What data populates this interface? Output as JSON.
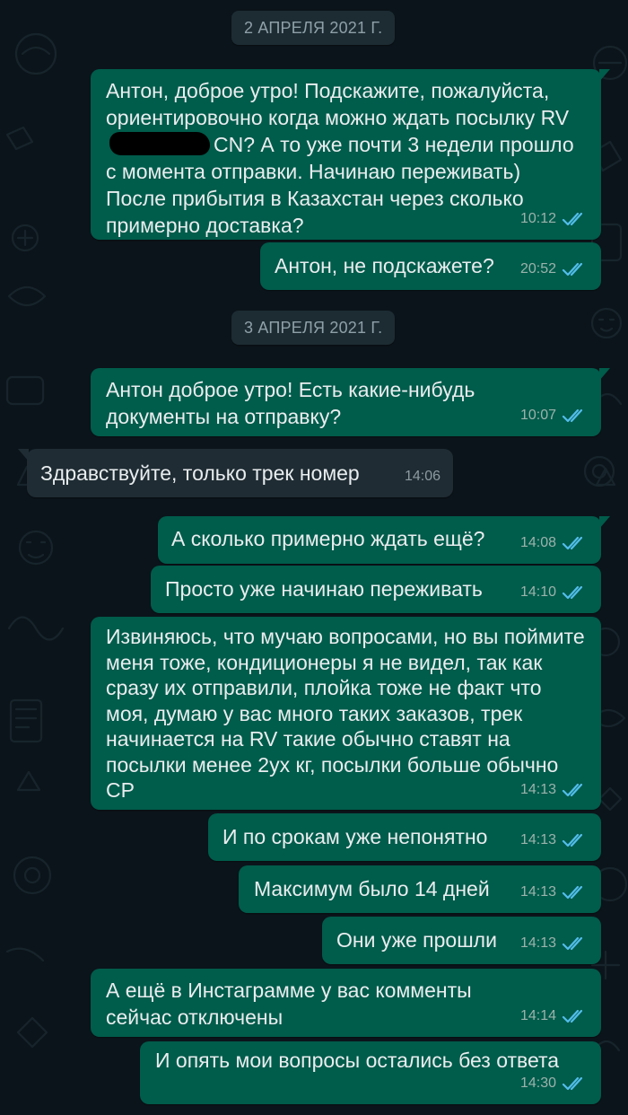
{
  "colors": {
    "background": "#0b141a",
    "outgoing_bubble": "#005c4b",
    "incoming_bubble": "#1f2c33",
    "read_ticks": "#53bdeb",
    "date_pill": "#1d2c33"
  },
  "dates": {
    "d1": "2 АПРЕЛЯ 2021 Г.",
    "d2": "3 АПРЕЛЯ 2021 Г."
  },
  "messages": [
    {
      "direction": "outgoing",
      "text_before": "Антон, доброе утро! Подскажите, пожалуйста, ориентировочно когда можно ждать посылку RV",
      "redacted": true,
      "text_after": "CN? А то уже почти 3 недели прошло с момента отправки. Начинаю переживать) После прибытия в Казахстан через сколько примерно доставка?",
      "time": "10:12",
      "status": "read"
    },
    {
      "direction": "outgoing",
      "text": "Антон, не подскажете?",
      "time": "20:52",
      "status": "read"
    },
    {
      "direction": "outgoing",
      "text": "Антон доброе утро! Есть какие-нибудь документы на отправку?",
      "time": "10:07",
      "status": "read"
    },
    {
      "direction": "incoming",
      "text": "Здравствуйте, только трек номер",
      "time": "14:06"
    },
    {
      "direction": "outgoing",
      "text": "А сколько примерно ждать ещё?",
      "time": "14:08",
      "status": "read"
    },
    {
      "direction": "outgoing",
      "text": "Просто уже начинаю переживать",
      "time": "14:10",
      "status": "read"
    },
    {
      "direction": "outgoing",
      "text": "Извиняюсь, что мучаю вопросами, но вы поймите меня тоже, кондиционеры я не видел, так как сразу их отправили, плойка тоже не факт что моя, думаю у вас много таких заказов, трек начинается на RV такие обычно ставят на посылки менее 2ух кг, посылки больше обычно CP",
      "time": "14:13",
      "status": "read"
    },
    {
      "direction": "outgoing",
      "text": "И по срокам уже непонятно",
      "time": "14:13",
      "status": "read"
    },
    {
      "direction": "outgoing",
      "text": "Максимум было 14 дней",
      "time": "14:13",
      "status": "read"
    },
    {
      "direction": "outgoing",
      "text": "Они уже прошли",
      "time": "14:13",
      "status": "read"
    },
    {
      "direction": "outgoing",
      "text": "А ещё в Инстаграмме у вас комменты сейчас отключены",
      "time": "14:14",
      "status": "read"
    },
    {
      "direction": "outgoing",
      "text": "И опять мои вопросы остались без ответа",
      "time": "14:30",
      "status": "read"
    }
  ]
}
